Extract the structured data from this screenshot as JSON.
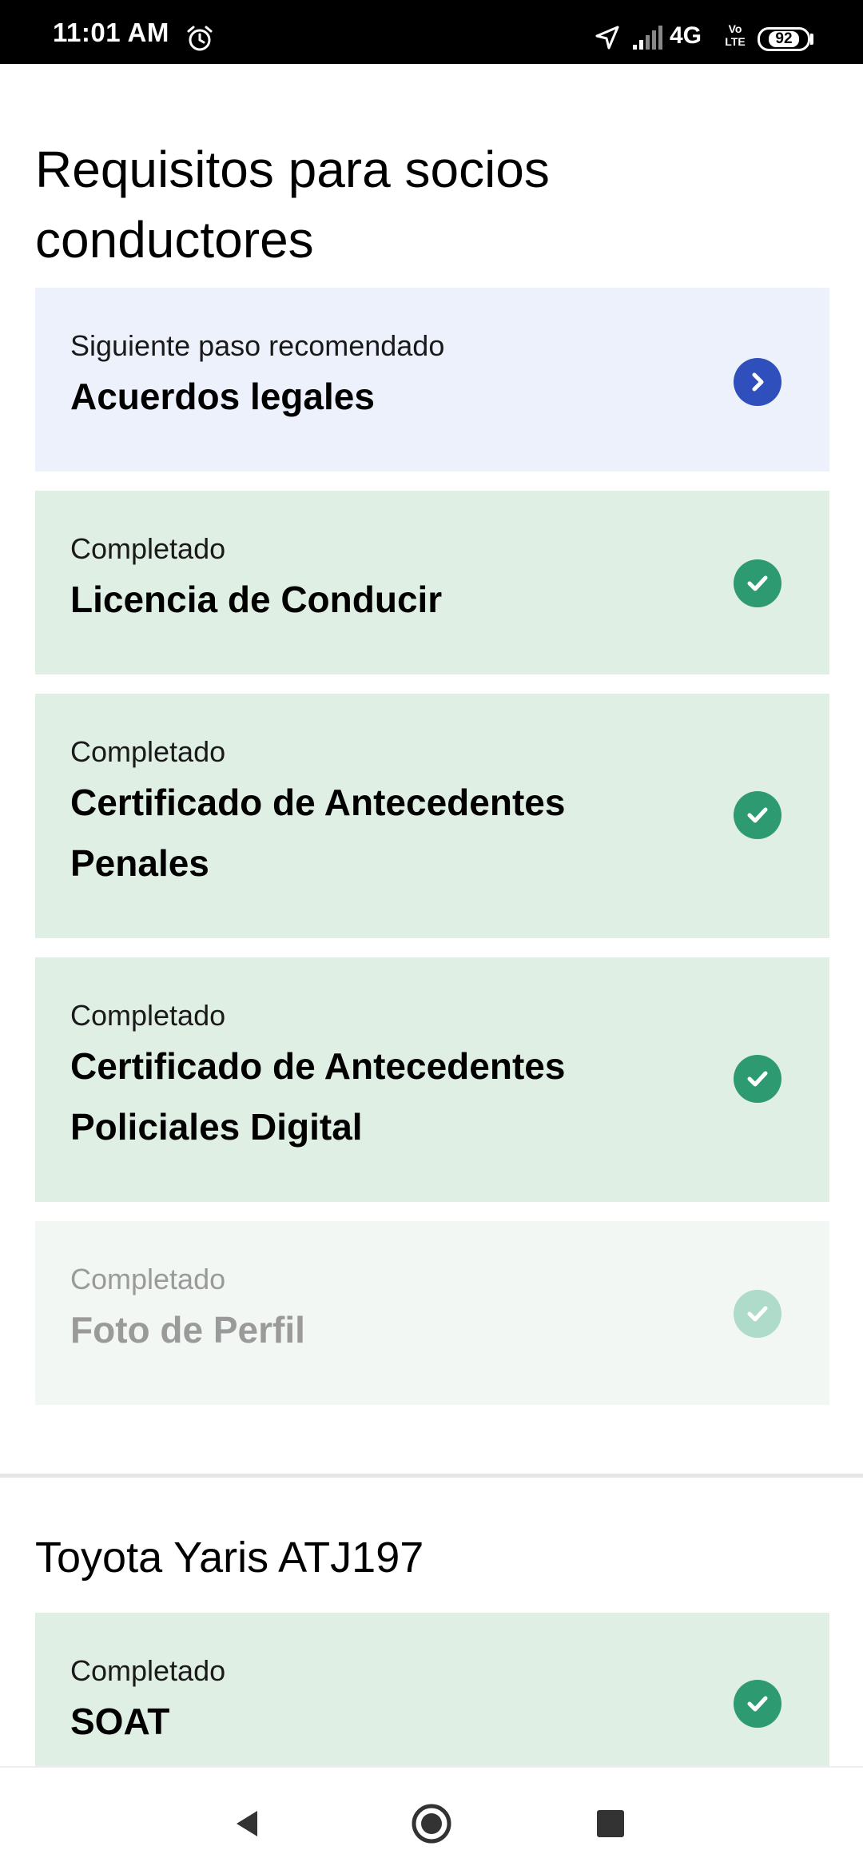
{
  "status_bar": {
    "time": "11:01 AM",
    "network": "4G",
    "volte_top": "Vo",
    "volte_bottom": "LTE",
    "battery": "92",
    "icons": [
      "alarm-icon",
      "location-arrow-icon",
      "signal-icon",
      "battery-icon"
    ]
  },
  "header": {
    "title": "Requisitos para socios conductores"
  },
  "requirements": [
    {
      "label": "Siguiente paso recomendado",
      "title": "Acuerdos legales",
      "state": "next",
      "icon": "chevron-right-icon"
    },
    {
      "label": "Completado",
      "title": "Licencia de Conducir",
      "state": "done",
      "icon": "check-icon"
    },
    {
      "label": "Completado",
      "title": "Certificado de Antecedentes Penales",
      "state": "done",
      "icon": "check-icon"
    },
    {
      "label": "Completado",
      "title": "Certificado de Antecedentes Policiales Digital",
      "state": "done",
      "icon": "check-icon"
    },
    {
      "label": "Completado",
      "title": "Foto de Perfil",
      "state": "done-dim",
      "icon": "check-icon"
    }
  ],
  "vehicle_section": {
    "title": "Toyota Yaris ATJ197",
    "items": [
      {
        "label": "Completado",
        "title": "SOAT",
        "state": "done",
        "icon": "check-icon"
      }
    ]
  },
  "nav_bar": {
    "icons": [
      "back-icon",
      "home-icon",
      "recents-icon"
    ]
  },
  "colors": {
    "next_bg": "#edf1fc",
    "done_bg": "#e0efe3",
    "accent_blue": "#2f4fbd",
    "accent_green": "#2e9a71"
  }
}
